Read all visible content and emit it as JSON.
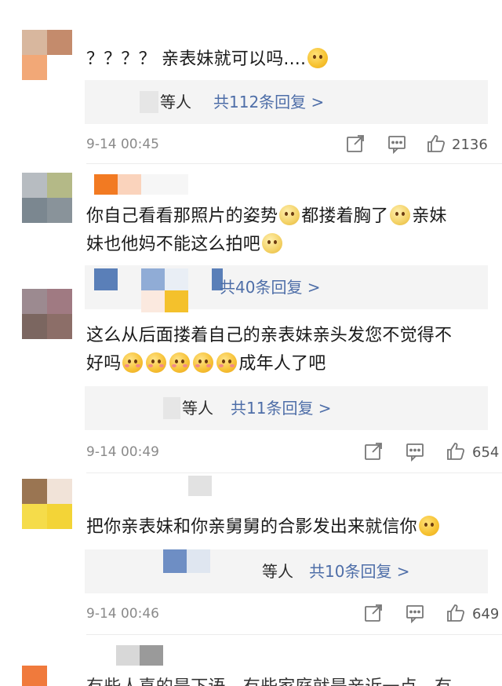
{
  "comments": [
    {
      "text_parts": [
        "？？？？ 亲表妹就可以吗...."
      ],
      "replies": {
        "suffix": "等人",
        "count_label": "共112条回复 >"
      },
      "time": "9-14 00:45",
      "likes": "2136"
    },
    {
      "text_parts": [
        "你自己看看那照片的姿势",
        "都搂着胸了",
        "亲妹",
        "妹也他妈不能这么拍吧"
      ],
      "replies": {
        "suffix": "",
        "count_label": "共40条回复 >"
      }
    },
    {
      "text_parts": [
        "这么从后面搂着自己的亲表妹亲头发您不觉得不",
        "好吗",
        "成年人了吧"
      ],
      "replies": {
        "suffix": "等人",
        "count_label": "共11条回复 >"
      },
      "time": "9-14 00:49",
      "likes": "654"
    },
    {
      "text_parts": [
        "把你亲表妹和你亲舅舅的合影发出来就信你"
      ],
      "replies": {
        "suffix": "等人",
        "count_label": "共10条回复 >"
      },
      "time": "9-14 00:46",
      "likes": "649"
    },
    {
      "text_parts": [
        "有些人喜的是下语，有些家庭就是亲近一点，有"
      ]
    }
  ],
  "icons": [
    "share-icon",
    "comment-icon",
    "like-icon"
  ],
  "colors": {
    "link": "#4e6ea8",
    "meta": "#8a8a8a",
    "reply_bg": "#f4f4f4"
  }
}
